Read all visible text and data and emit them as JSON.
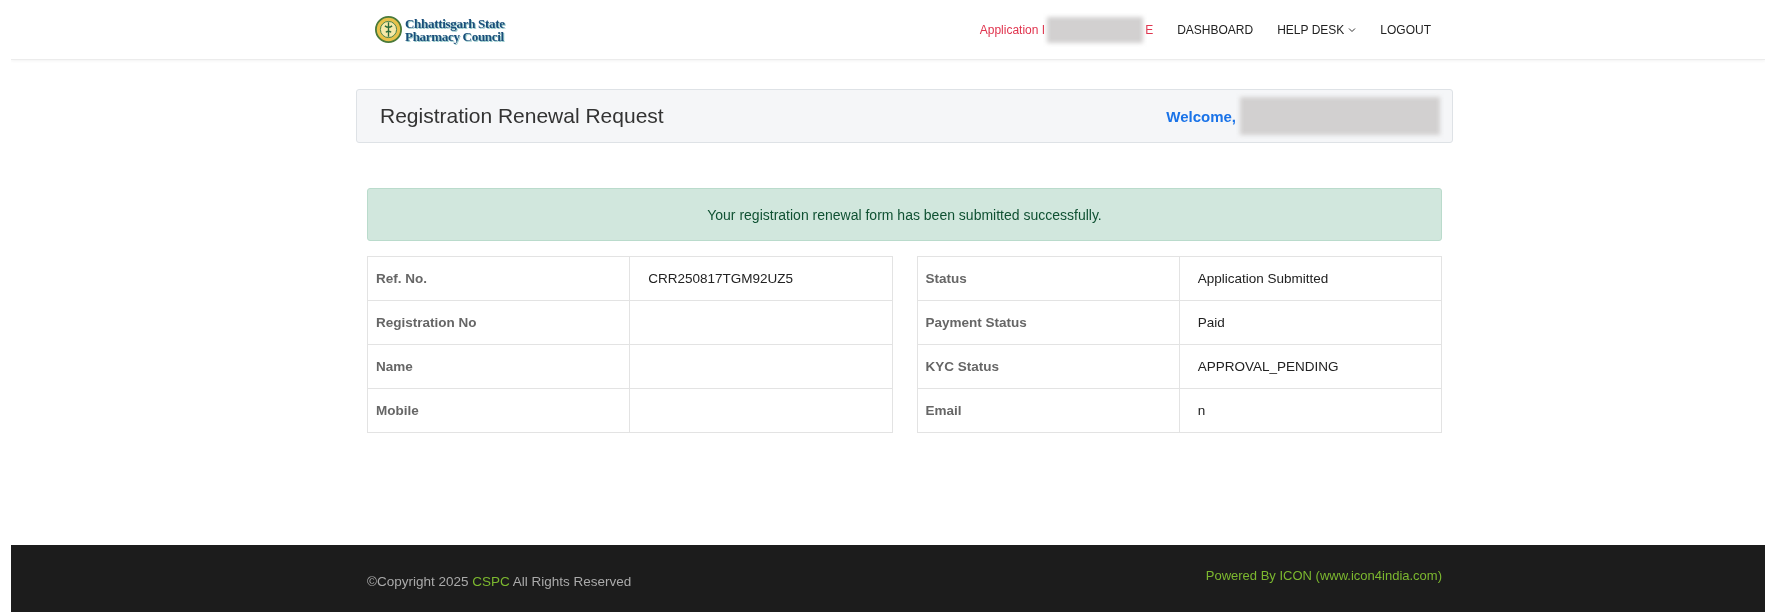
{
  "header": {
    "logo_lines": [
      "Chhattisgarh State",
      "Pharmacy Council"
    ],
    "nav": [
      {
        "kind": "redacted",
        "label_start": "Application I",
        "label_end": "E"
      },
      {
        "kind": "link",
        "label": "DASHBOARD"
      },
      {
        "kind": "dropdown",
        "label": "HELP DESK"
      },
      {
        "kind": "link",
        "label": "LOGOUT"
      }
    ]
  },
  "title_bar": {
    "title": "Registration Renewal Request",
    "welcome": "Welcome,"
  },
  "alert": "Your registration renewal form has been submitted successfully.",
  "tables": [
    {
      "rows": [
        {
          "label": "Ref. No.",
          "value": "CRR250817TGM92UZ5"
        },
        {
          "label": "Registration No",
          "value": ""
        },
        {
          "label": "Name",
          "value": ""
        },
        {
          "label": "Mobile",
          "value": ""
        }
      ]
    },
    {
      "rows": [
        {
          "label": "Status",
          "value": "Application Submitted"
        },
        {
          "label": "Payment Status",
          "value": "Paid"
        },
        {
          "label": "KYC Status",
          "value": "APPROVAL_PENDING"
        },
        {
          "label": "Email",
          "value": "n"
        }
      ]
    }
  ],
  "footer": {
    "copyright_start": "©Copyright 2025",
    "brand": "CSPC",
    "copyright_end": "All Rights Reserved",
    "powered": "Powered By ICON (www.icon4india.com)"
  }
}
